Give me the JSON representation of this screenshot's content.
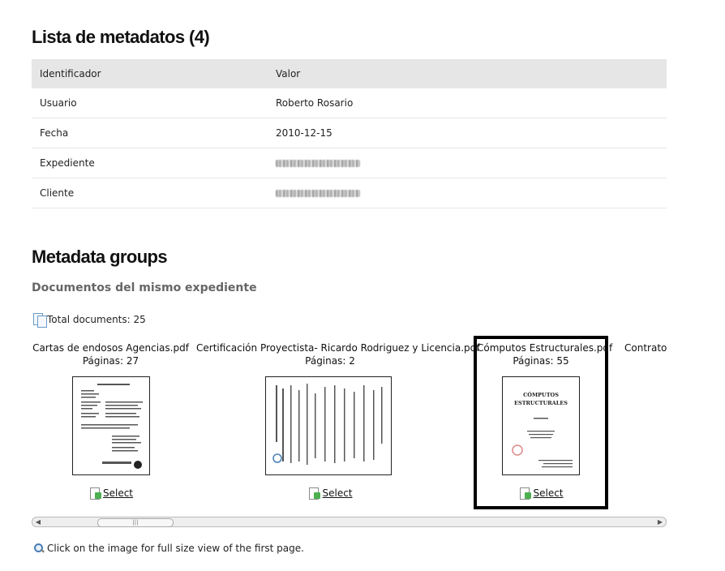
{
  "metadata_section": {
    "title": "Lista de metadatos (4)",
    "header_identifier": "Identificador",
    "header_value": "Valor",
    "rows": [
      {
        "id": "Usuario",
        "value": "Roberto Rosario"
      },
      {
        "id": "Fecha",
        "value": "2010-12-15"
      },
      {
        "id": "Expediente",
        "value": ""
      },
      {
        "id": "Cliente",
        "value": ""
      }
    ]
  },
  "groups_section": {
    "title": "Metadata groups",
    "subtitle": "Documentos del mismo expediente",
    "total": "Total documents: 25",
    "select_label": "Select",
    "documents": [
      {
        "name": "Cartas de endosos Agencias.pdf",
        "pages": "Páginas: 27"
      },
      {
        "name": "Certificación Proyectista- Ricardo Rodriguez y Licencia.pdf",
        "pages": "Páginas: 2"
      },
      {
        "name": "Cómputos Estructurales.pdf",
        "pages": "Páginas: 55",
        "selected": true,
        "cover_title": "Cómputos Estructurales"
      },
      {
        "name": "Contrato c",
        "pages": ""
      }
    ],
    "scrollbar_grip": "|||"
  },
  "hint": "Click on the image for full size view of the first page.",
  "icons": {
    "total": "documents-icon",
    "select": "select-document-icon",
    "hint": "magnifier-icon"
  }
}
